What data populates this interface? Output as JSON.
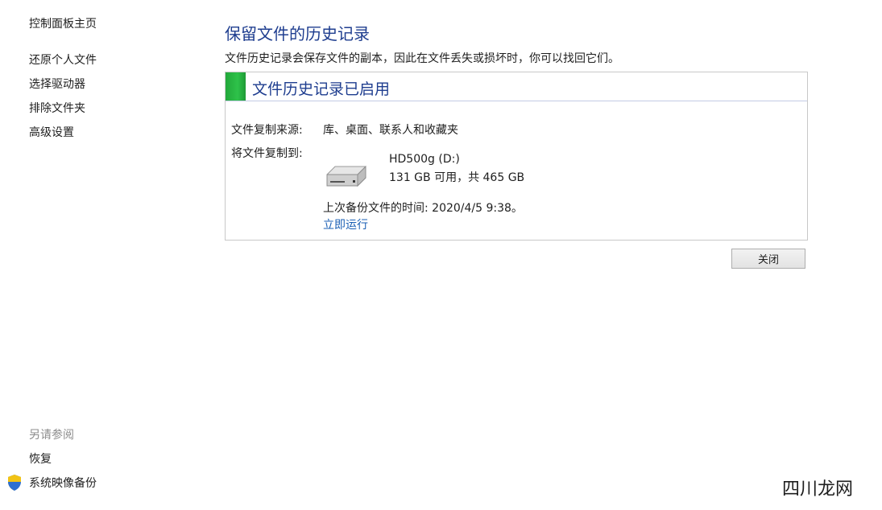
{
  "nav": {
    "home": "控制面板主页",
    "items": [
      "还原个人文件",
      "选择驱动器",
      "排除文件夹",
      "高级设置"
    ],
    "see_also_title": "另请参阅",
    "see_also": [
      "恢复",
      "系统映像备份"
    ]
  },
  "main": {
    "title": "保留文件的历史记录",
    "description": "文件历史记录会保存文件的副本，因此在文件丢失或损坏时，你可以找回它们。",
    "status_title": "文件历史记录已启用",
    "copy_from_label": "文件复制来源:",
    "copy_from_value": "库、桌面、联系人和收藏夹",
    "copy_to_label": "将文件复制到:",
    "drive": {
      "name": "HD500g (D:)",
      "space": "131 GB 可用，共 465 GB",
      "icon": "hard-drive-icon"
    },
    "last_backup": "上次备份文件的时间: 2020/4/5 9:38。",
    "run_now": "立即运行",
    "close_button": "关闭"
  },
  "watermark": "四川龙网",
  "colors": {
    "title_blue": "#1e3d8f",
    "link_blue": "#1a5fb4",
    "status_green": "#2ec24a"
  }
}
